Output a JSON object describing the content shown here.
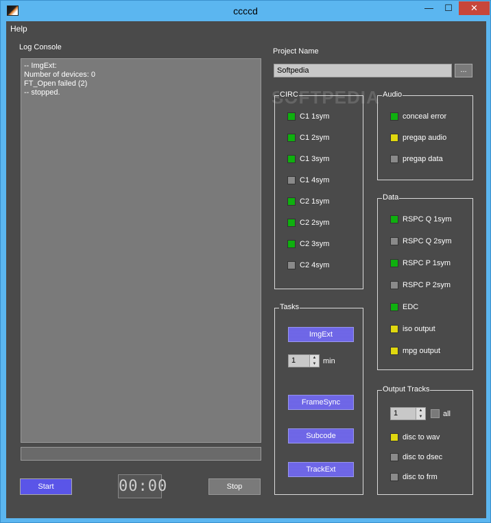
{
  "window": {
    "title": "ccccd",
    "min_label": "—",
    "max_label": "☐",
    "close_label": "✕"
  },
  "menu": {
    "help": "Help"
  },
  "log": {
    "label": "Log Console",
    "lines": [
      "-- ImgExt:",
      "Number of devices: 0",
      "FT_Open failed (2)",
      "-- stopped."
    ]
  },
  "controls": {
    "start": "Start",
    "stop": "Stop",
    "timer": "00:00",
    "progress": 0
  },
  "project": {
    "label": "Project Name",
    "value": "Softpedia",
    "browse": "..."
  },
  "watermark": "SOFTPEDIA",
  "colors": {
    "green": "#0fb00f",
    "yellow": "#e0d80f",
    "gray": "#8a8a8a",
    "accent": "#5a55e8"
  },
  "circ": {
    "title": "CIRC",
    "items": [
      {
        "label": "C1 1sym",
        "state": "green"
      },
      {
        "label": "C1 2sym",
        "state": "green"
      },
      {
        "label": "C1 3sym",
        "state": "green"
      },
      {
        "label": "C1 4sym",
        "state": "gray"
      },
      {
        "label": "C2 1sym",
        "state": "green"
      },
      {
        "label": "C2 2sym",
        "state": "green"
      },
      {
        "label": "C2 3sym",
        "state": "green"
      },
      {
        "label": "C2 4sym",
        "state": "gray"
      }
    ]
  },
  "audio": {
    "title": "Audio",
    "items": [
      {
        "label": "conceal error",
        "state": "green"
      },
      {
        "label": "pregap audio",
        "state": "yellow"
      },
      {
        "label": "pregap data",
        "state": "gray"
      }
    ]
  },
  "data": {
    "title": "Data",
    "items": [
      {
        "label": "RSPC Q  1sym",
        "state": "green"
      },
      {
        "label": "RSPC Q  2sym",
        "state": "gray"
      },
      {
        "label": "RSPC P  1sym",
        "state": "green"
      },
      {
        "label": "RSPC P  2sym",
        "state": "gray"
      },
      {
        "label": "EDC",
        "state": "green"
      },
      {
        "label": "iso output",
        "state": "yellow"
      },
      {
        "label": "mpg output",
        "state": "yellow"
      }
    ]
  },
  "tasks": {
    "title": "Tasks",
    "imgext": "ImgExt",
    "min_value": "1",
    "min_label": "min",
    "framesync": "FrameSync",
    "subcode": "Subcode",
    "trackext": "TrackExt"
  },
  "output": {
    "title": "Output Tracks",
    "track_value": "1",
    "all_label": "all",
    "items": [
      {
        "label": "disc to wav",
        "state": "yellow"
      },
      {
        "label": "disc to dsec",
        "state": "gray"
      },
      {
        "label": "disc to frm",
        "state": "gray"
      }
    ]
  }
}
